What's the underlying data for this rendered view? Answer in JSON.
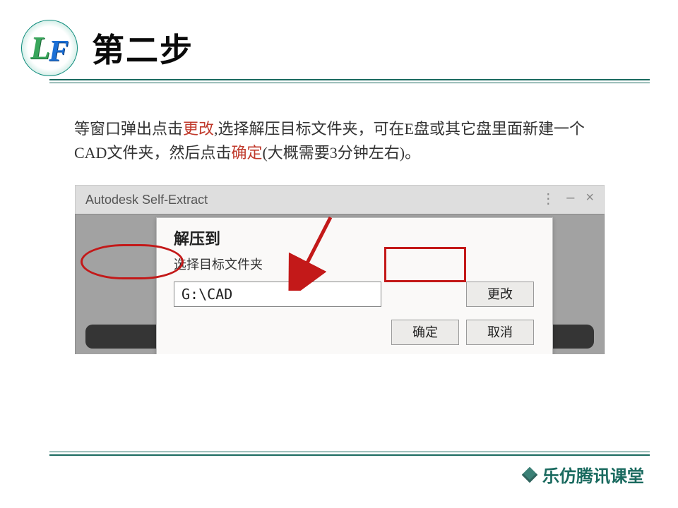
{
  "logo": {
    "letter1": "L",
    "letter2": "F"
  },
  "step_title": "第二步",
  "instruction": {
    "t1": "等窗口弹出点击",
    "a1": "更改",
    "t2": ",选择解压目标文件夹，可在E盘或其它盘里面新建一个CAD文件夹，然后点击",
    "a2": "确定",
    "t3": "(大概需要3分钟左右)。"
  },
  "screenshot": {
    "parent_title": "Autodesk Self-Extract",
    "dot1": "⋮",
    "min": "–",
    "close": "×",
    "dialog": {
      "title": "解压到",
      "subtitle": "选择目标文件夹",
      "path_value": "G:\\CAD",
      "change": "更改",
      "ok": "确定",
      "cancel": "取消"
    }
  },
  "footer": {
    "brand": "乐仿腾讯课堂"
  }
}
